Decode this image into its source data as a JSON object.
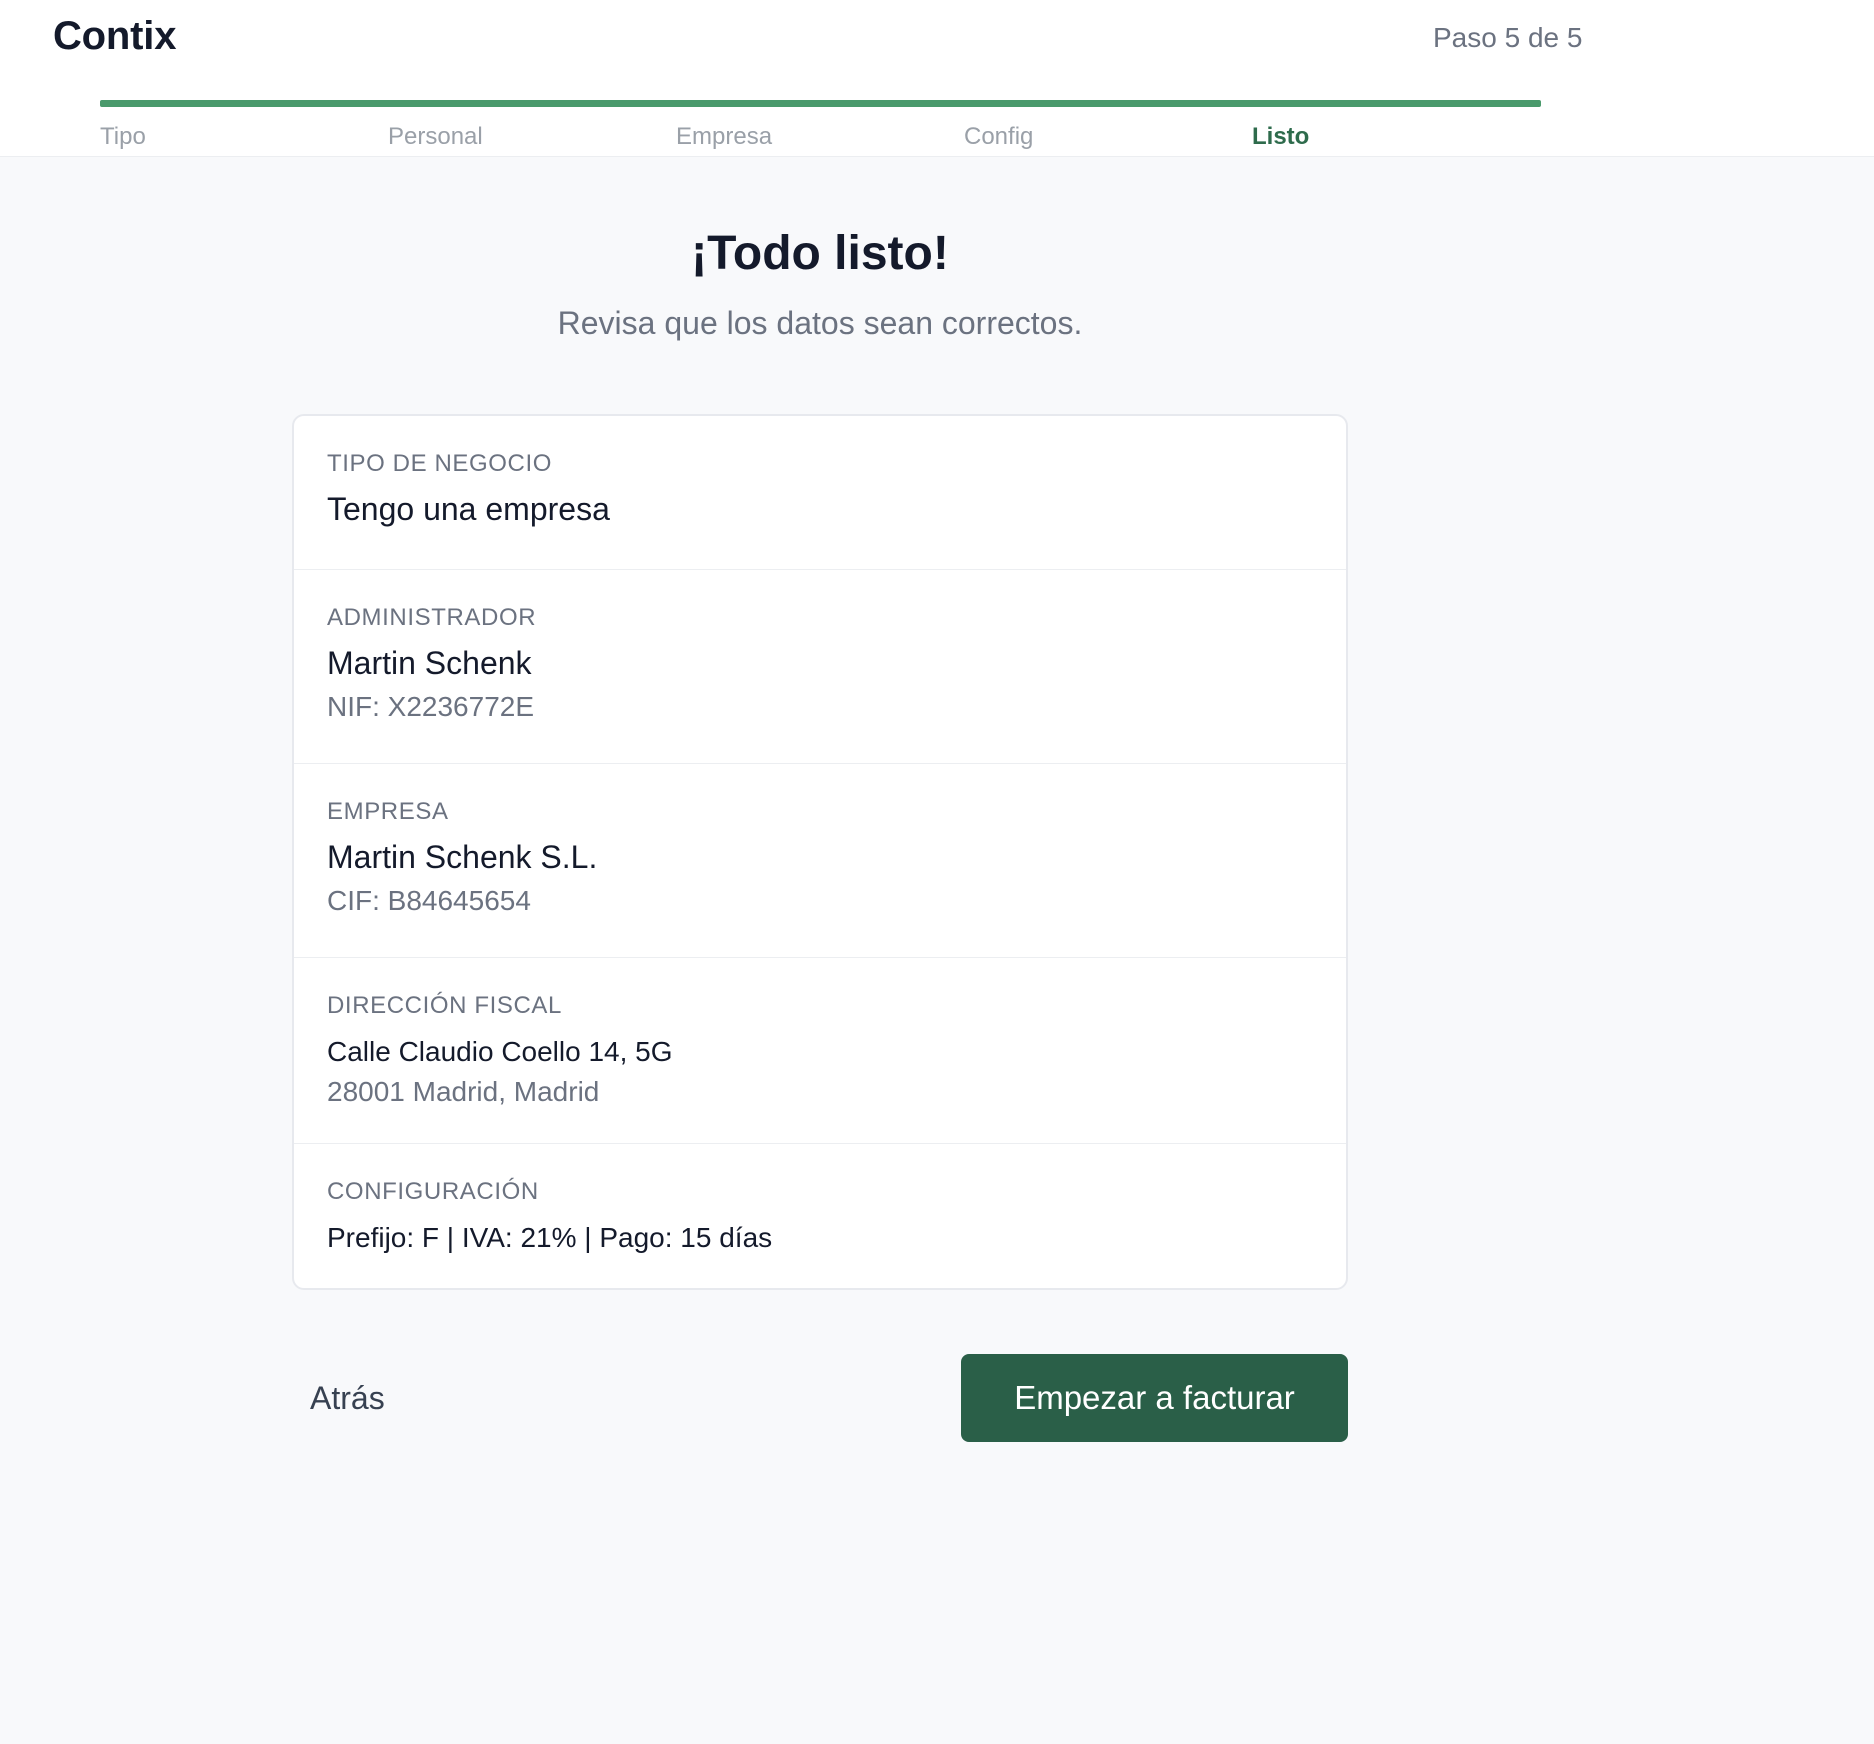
{
  "app": {
    "brand": "Contix",
    "step_count": "Paso 5 de 5"
  },
  "progress": {
    "fraction": 1.0,
    "color": "#4a9a6c"
  },
  "steps": [
    {
      "label": "Tipo",
      "active": false
    },
    {
      "label": "Personal",
      "active": false
    },
    {
      "label": "Empresa",
      "active": false
    },
    {
      "label": "Config",
      "active": false
    },
    {
      "label": "Listo",
      "active": true
    }
  ],
  "main": {
    "title": "¡Todo listo!",
    "subtitle": "Revisa que los datos sean correctos."
  },
  "summary": {
    "tipo": {
      "label": "TIPO DE NEGOCIO",
      "value": "Tengo una empresa"
    },
    "admin": {
      "label": "ADMINISTRADOR",
      "value": "Martin Schenk",
      "sub": "NIF: X2236772E"
    },
    "empresa": {
      "label": "EMPRESA",
      "value": "Martin Schenk S.L.",
      "sub": "CIF: B84645654"
    },
    "direccion": {
      "label": "DIRECCIÓN FISCAL",
      "value": "Calle Claudio Coello 14, 5G",
      "sub": "28001 Madrid, Madrid"
    },
    "config": {
      "label": "CONFIGURACIÓN",
      "value": "Prefijo: F | IVA: 21% | Pago: 15 días"
    }
  },
  "actions": {
    "back_label": "Atrás",
    "primary_label": "Empezar a facturar"
  },
  "colors": {
    "accent": "#2a5f48",
    "progress": "#4a9a6c",
    "active_step": "#2e6b4c"
  }
}
